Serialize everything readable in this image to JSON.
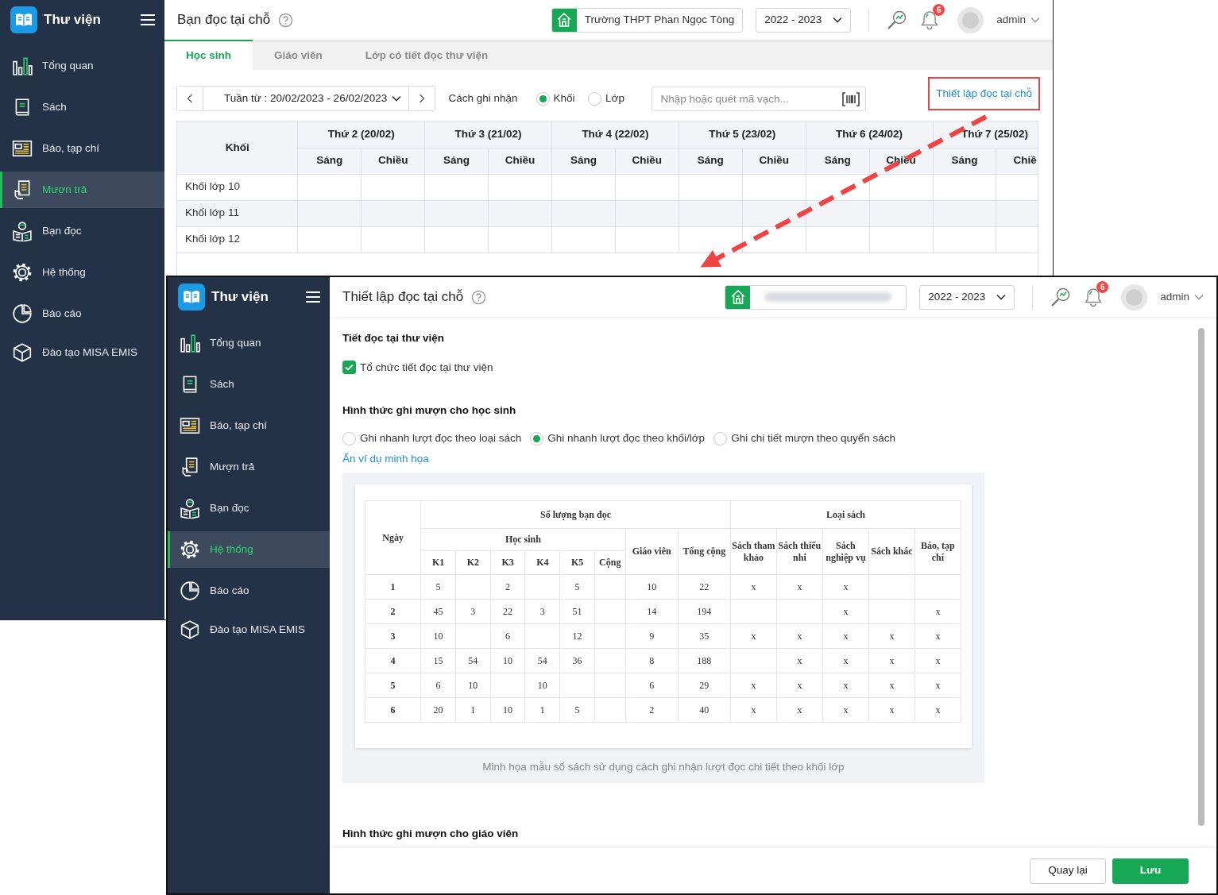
{
  "main_screen": {
    "app_name": "Thư viện",
    "sidebar": [
      {
        "label": "Tổng quan",
        "kind": "chart",
        "selected": false
      },
      {
        "label": "Sách",
        "kind": "book",
        "selected": false
      },
      {
        "label": "Báo, tạp chí",
        "kind": "news",
        "selected": false
      },
      {
        "label": "Mượn trả",
        "kind": "borrow",
        "selected": true
      },
      {
        "label": "Bạn đọc",
        "kind": "reader",
        "selected": false
      },
      {
        "label": "Hệ thống",
        "kind": "gear",
        "selected": false
      },
      {
        "label": "Báo cáo",
        "kind": "pie",
        "selected": false
      },
      {
        "label": "Đào tạo MISA EMIS",
        "kind": "cube",
        "selected": false
      }
    ],
    "header": {
      "title": "Bạn đọc tại chỗ",
      "school": "Trường THPT Phan Ngọc Tòng",
      "year": "2022 - 2023",
      "notifications": "6",
      "user": "admin"
    },
    "tabs": [
      {
        "label": "Học sinh",
        "selected": true
      },
      {
        "label": "Giáo viên",
        "selected": false
      },
      {
        "label": "Lớp có tiết đọc thư viện",
        "selected": false
      }
    ],
    "week": "Tuần từ : 20/02/2023 - 26/02/2023",
    "record_label": "Cách ghi nhận",
    "record_options": [
      {
        "label": "Khối",
        "selected": true
      },
      {
        "label": "Lớp",
        "selected": false
      }
    ],
    "barcode_search": {
      "placeholder": "Nhập hoặc quét mã vạch..."
    },
    "settings_link": {
      "label": "Thiết lập đọc tại chỗ",
      "highlighted": true
    },
    "table": {
      "first_column": "Khối",
      "days": [
        {
          "label": "Thứ 2 (20/02)",
          "sessions": [
            "Sáng",
            "Chiều"
          ]
        },
        {
          "label": "Thứ 3 (21/02)",
          "sessions": [
            "Sáng",
            "Chiều"
          ]
        },
        {
          "label": "Thứ 4 (22/02)",
          "sessions": [
            "Sáng",
            "Chiều"
          ]
        },
        {
          "label": "Thứ 5 (23/02)",
          "sessions": [
            "Sáng",
            "Chiều"
          ]
        },
        {
          "label": "Thứ 6 (24/02)",
          "sessions": [
            "Sáng",
            "Chiều"
          ]
        },
        {
          "label": "Thứ 7 (25/02)",
          "sessions": [
            "Sáng",
            "Chiề"
          ]
        }
      ],
      "rows": [
        "Khối lớp 10",
        "Khối lớp 11",
        "Khối lớp 12"
      ]
    }
  },
  "settings_screen": {
    "app_name": "Thư viện",
    "sidebar": [
      {
        "label": "Tổng quan",
        "kind": "chart",
        "selected": false
      },
      {
        "label": "Sách",
        "kind": "book",
        "selected": false
      },
      {
        "label": "Báo, tạp chí",
        "kind": "news",
        "selected": false
      },
      {
        "label": "Mượn trả",
        "kind": "borrow",
        "selected": false
      },
      {
        "label": "Bạn đọc",
        "kind": "reader",
        "selected": false
      },
      {
        "label": "Hệ thống",
        "kind": "gear",
        "selected": true
      },
      {
        "label": "Báo cáo",
        "kind": "pie",
        "selected": false
      },
      {
        "label": "Đào tạo MISA EMIS",
        "kind": "cube",
        "selected": false
      }
    ],
    "header": {
      "title": "Thiết lập đọc tại chỗ",
      "year": "2022 - 2023",
      "notifications": "6",
      "user": "admin"
    },
    "library_period": {
      "heading": "Tiết đọc tại thư viện",
      "option": {
        "label": "Tổ chức tiết đọc tại thư viện",
        "checked": true
      }
    },
    "student_mode": {
      "heading": "Hình thức ghi mượn cho học sinh",
      "options": [
        {
          "label": "Ghi nhanh lượt đọc theo loại sách",
          "selected": false
        },
        {
          "label": "Ghi nhanh lượt đọc theo khối/lớp",
          "selected": true
        },
        {
          "label": "Ghi chi tiết mượn theo quyển sách",
          "selected": false
        }
      ],
      "toggle_link": "Ẩn ví dụ minh họa"
    },
    "example": {
      "header_rows": [
        [
          {
            "text": "Ngày",
            "rowspan": 3
          },
          {
            "text": "Số lượng bạn đọc",
            "colspan": 8
          },
          {
            "text": "Loại sách",
            "colspan": 5
          }
        ],
        [
          {
            "text": "Học sinh",
            "colspan": 6
          },
          {
            "text": "Giáo viên",
            "rowspan": 2
          },
          {
            "text": "Tổng cộng",
            "rowspan": 2
          },
          {
            "text": "Sách tham khảo",
            "rowspan": 2
          },
          {
            "text": "Sách thiếu nhi",
            "rowspan": 2
          },
          {
            "text": "Sách nghiệp vụ",
            "rowspan": 2
          },
          {
            "text": "Sách khác",
            "rowspan": 2
          },
          {
            "text": "Báo, tạp chí",
            "rowspan": 2
          }
        ],
        [
          {
            "text": "K1"
          },
          {
            "text": "K2"
          },
          {
            "text": "K3"
          },
          {
            "text": "K4"
          },
          {
            "text": "K5"
          },
          {
            "text": "Cộng"
          }
        ]
      ],
      "rows": [
        [
          "1",
          "5",
          null,
          "2",
          null,
          "5",
          null,
          "10",
          "22",
          "x",
          "x",
          "x",
          null,
          null
        ],
        [
          "2",
          "45",
          "3",
          "22",
          "3",
          "51",
          null,
          "14",
          "194",
          null,
          null,
          "x",
          null,
          "x"
        ],
        [
          "3",
          "10",
          null,
          "6",
          null,
          "12",
          null,
          "9",
          "35",
          "x",
          "x",
          "x",
          "x",
          "x"
        ],
        [
          "4",
          "15",
          "54",
          "10",
          "54",
          "36",
          null,
          "8",
          "188",
          null,
          "x",
          "x",
          "x",
          "x"
        ],
        [
          "5",
          "6",
          "10",
          null,
          "10",
          null,
          null,
          "6",
          "29",
          "x",
          "x",
          "x",
          "x",
          "x"
        ],
        [
          "6",
          "20",
          "1",
          "10",
          "1",
          "5",
          null,
          "2",
          "40",
          "x",
          "x",
          "x",
          "x",
          "x"
        ]
      ],
      "caption": "Minh họa mẫu sổ sách sử dụng cách ghi nhận lượt đọc chi tiết theo khối lớp"
    },
    "teacher_mode": {
      "heading": "Hình thức ghi mượn cho giáo viên"
    },
    "buttons": [
      {
        "label": "Quay lại",
        "kind": "secondary"
      },
      {
        "label": "Lưu",
        "kind": "primary"
      }
    ]
  }
}
